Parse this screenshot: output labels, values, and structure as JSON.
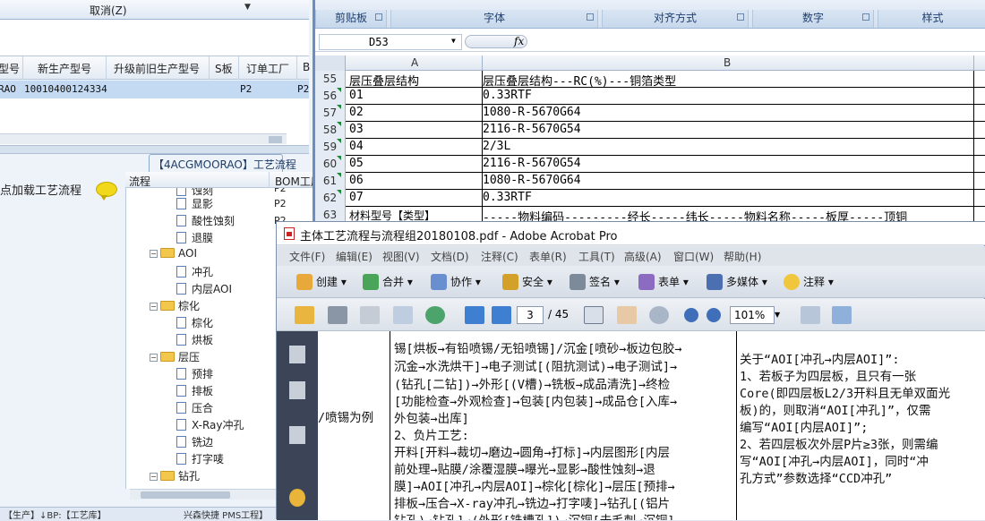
{
  "erp": {
    "cancel_label": "取消(Z)",
    "grid_headers": [
      "型号",
      "新生产型号",
      "升级前旧生产型号",
      "S板",
      "订单工厂",
      "B"
    ],
    "grid_row": {
      "c0": "RAO",
      "c1": "10010400124334",
      "c3": "P2",
      "c4": "P2"
    },
    "process_tab": "【4ACGMOORAO】工艺流程",
    "left_label": "点加载工艺流程",
    "tree_header": {
      "col1": "流程",
      "col2": "BOM工厂"
    },
    "tree": [
      {
        "label": "蚀刻",
        "bom": "P2"
      },
      {
        "label": "显影",
        "bom": "P2"
      },
      {
        "label": "酸性蚀刻",
        "bom": "P2"
      },
      {
        "label": "退膜",
        "bom": ""
      },
      {
        "label": "AOI",
        "bom": ""
      },
      {
        "label": "冲孔",
        "bom": ""
      },
      {
        "label": "内层AOI",
        "bom": ""
      },
      {
        "label": "棕化",
        "bom": ""
      },
      {
        "label": "棕化",
        "bom": ""
      },
      {
        "label": "烘板",
        "bom": ""
      },
      {
        "label": "层压",
        "bom": ""
      },
      {
        "label": "预排",
        "bom": ""
      },
      {
        "label": "排板",
        "bom": ""
      },
      {
        "label": "压合",
        "bom": ""
      },
      {
        "label": "X-Ray冲孔",
        "bom": ""
      },
      {
        "label": "铣边",
        "bom": ""
      },
      {
        "label": "打字唛",
        "bom": ""
      },
      {
        "label": "钻孔",
        "bom": ""
      }
    ],
    "status": [
      "【生产】↓BP:【工艺库】",
      "兴森快捷 PMS工程】"
    ]
  },
  "excel": {
    "ribbon_groups": [
      "剪贴板",
      "字体",
      "对齐方式",
      "数字",
      "样式"
    ],
    "name_box": "D53",
    "fx": "fx",
    "columns": [
      "A",
      "B"
    ],
    "rows": [
      {
        "n": "55",
        "a": "层压叠层结构",
        "b": "层压叠层结构---RC(%)---铜箔类型"
      },
      {
        "n": "56",
        "a": "01",
        "b": "0.33RTF"
      },
      {
        "n": "57",
        "a": "02",
        "b": "1080-R-5670G64"
      },
      {
        "n": "58",
        "a": "03",
        "b": "2116-R-5670G54"
      },
      {
        "n": "59",
        "a": "04",
        "b": "2/3L"
      },
      {
        "n": "60",
        "a": "05",
        "b": "2116-R-5670G54"
      },
      {
        "n": "61",
        "a": "06",
        "b": "1080-R-5670G64"
      },
      {
        "n": "62",
        "a": "07",
        "b": "0.33RTF"
      },
      {
        "n": "63",
        "a": "材料型号【类型】",
        "b": "-----物料编码---------经长-----纬长-----物料名称-----板厚-----顶铜"
      }
    ]
  },
  "acrobat": {
    "title": "主体工艺流程与流程组20180108.pdf - Adobe Acrobat Pro",
    "menu": [
      "文件(F)",
      "编辑(E)",
      "视图(V)",
      "文档(D)",
      "注释(C)",
      "表单(R)",
      "工具(T)",
      "高级(A)",
      "窗口(W)",
      "帮助(H)"
    ],
    "tools": [
      "创建",
      "合并",
      "协作",
      "安全",
      "签名",
      "表单",
      "多媒体",
      "注释"
    ],
    "page": "3",
    "page_total": "/ 45",
    "zoom": "101%",
    "doc_left_label": "/喷锡为例",
    "doc_mid": [
      "锡[烘板→有铅喷锡/无铅喷锡]/沉金[喷砂→板边包胶→",
      "沉金→水洗烘干]→电子测试[(阻抗测试)→电子测试]→",
      "(钻孔[二钻])→外形[(V槽)→铣板→成品清洗]→终检",
      "[功能检查→外观检查]→包装[内包装]→成品仓[入库→",
      "外包装→出库]",
      "2、负片工艺:",
      "开料[开料→裁切→磨边→圆角→打标]→内层图形[内层",
      "前处理→贴膜/涂覆湿膜→曝光→显影→酸性蚀刻→退",
      "膜]→AOI[冲孔→内层AOI]→棕化[棕化]→层压[预排→",
      "排板→压合→X-ray冲孔→铣边→打字唛]→钻孔[(铝片",
      "钻孔)→钻孔]→(外形[铣槽孔])→沉铜[去毛刺→沉铜]"
    ],
    "doc_right": [
      "关于“AOI[冲孔→内层AOI]”:",
      "1、若板子为四层板，且只有一张",
      "Core(即四层板L2/3开料且无单双面光",
      "板)的，则取消“AOI[冲孔]”，仅需",
      "编写“AOI[内层AOI]”;",
      "2、若四层板次外层P片≥3张，则需编",
      "写“AOI[冲孔→内层AOI]，同时“冲",
      "孔方式”参数选择“CCD冲孔”"
    ]
  }
}
